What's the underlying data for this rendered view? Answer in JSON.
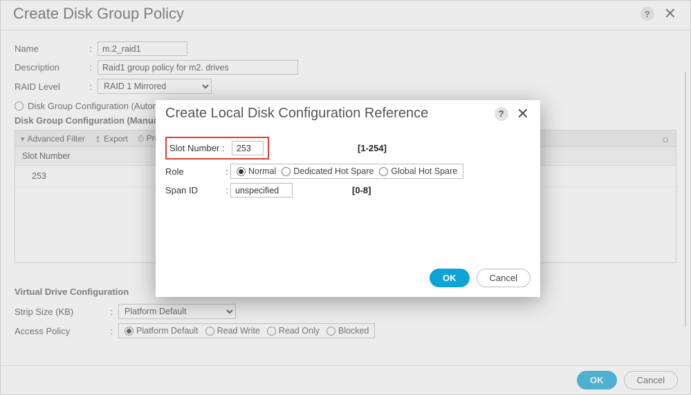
{
  "main": {
    "title": "Create Disk Group Policy",
    "name_label": "Name",
    "name_value": "m.2_raid1",
    "description_label": "Description",
    "description_value": "Raid1 group policy for m2. drives",
    "raid_label": "RAID Level",
    "raid_value": "RAID 1 Mirrored",
    "config_auto_label": "Disk Group Configuration (Automatic)",
    "config_manual_label": "Disk Group Configuration (Manual)",
    "toolbar": {
      "filter": "Advanced Filter",
      "export": "Export",
      "print": "Print"
    },
    "table_col": "Slot Number",
    "table_row_slot": "253",
    "vdc_title": "Virtual Drive Configuration",
    "strip_label": "Strip Size (KB)",
    "strip_value": "Platform Default",
    "access_label": "Access Policy",
    "access_opts": {
      "platform": "Platform Default",
      "rw": "Read Write",
      "ro": "Read Only",
      "blocked": "Blocked"
    },
    "ok": "OK",
    "cancel": "Cancel"
  },
  "modal": {
    "title": "Create Local Disk Configuration Reference",
    "slot_label": "Slot Number",
    "slot_value": "253",
    "slot_hint": "[1-254]",
    "role_label": "Role",
    "role_opts": {
      "normal": "Normal",
      "dhs": "Dedicated Hot Spare",
      "ghs": "Global Hot Spare"
    },
    "span_label": "Span ID",
    "span_value": "unspecified",
    "span_hint": "[0-8]",
    "ok": "OK",
    "cancel": "Cancel"
  }
}
